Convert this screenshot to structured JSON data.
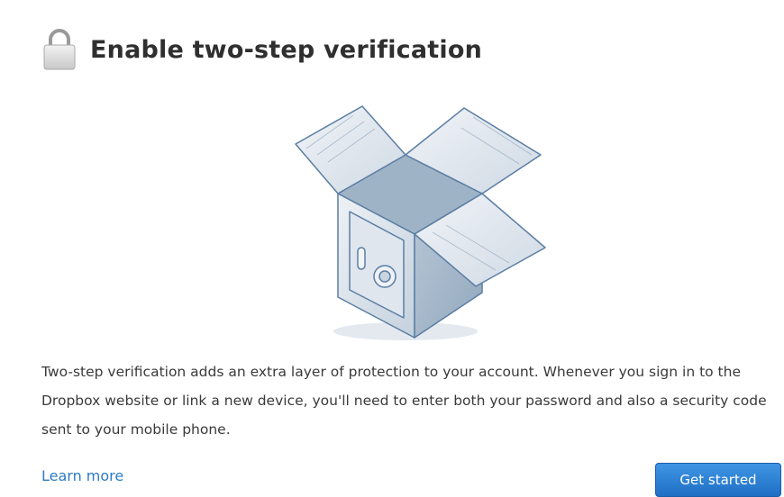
{
  "header": {
    "icon": "lock-icon",
    "title": "Enable two-step verification"
  },
  "illustration": {
    "icon": "dropbox-safe-illustration"
  },
  "body": {
    "description": "Two-step verification adds an extra layer of protection to your account. Whenever you sign in to the Dropbox website or link a new device, you'll need to enter both your password and also a security code sent to your mobile phone."
  },
  "footer": {
    "learn_more_label": "Learn more",
    "get_started_label": "Get started"
  },
  "colors": {
    "link": "#2d7bc4",
    "primary_button": "#2a7fd4",
    "illustration_stroke": "#5b7ea3"
  }
}
